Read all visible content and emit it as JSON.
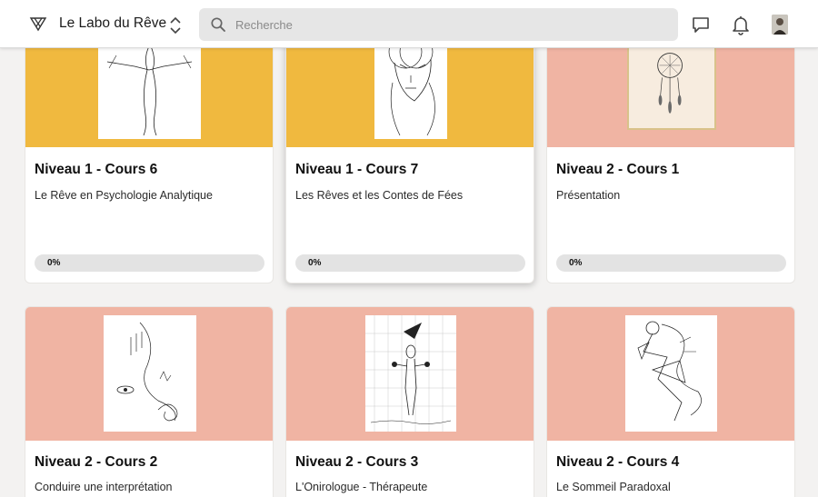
{
  "header": {
    "site_title": "Le Labo du Rêve",
    "search_placeholder": "Recherche",
    "icons": [
      "logo-icon",
      "switch-site-icon",
      "search-icon",
      "chat-icon",
      "bell-icon",
      "avatar"
    ]
  },
  "colors": {
    "banner_yellow": "#f0b93f",
    "banner_pink": "#f0b4a3",
    "page_bg": "#f3f2f1"
  },
  "cards": [
    {
      "title": "Niveau 1 - Cours 6",
      "subtitle": "Le Rêve en Psychologie Analytique",
      "progress_label": "0%",
      "progress": 0,
      "banner": "yellow"
    },
    {
      "title": "Niveau 1 - Cours 7",
      "subtitle": "Les Rêves et les Contes de Fées",
      "progress_label": "0%",
      "progress": 0,
      "banner": "yellow"
    },
    {
      "title": "Niveau 2 - Cours 1",
      "subtitle": "Présentation",
      "progress_label": "0%",
      "progress": 0,
      "banner": "pink"
    },
    {
      "title": "Niveau 2 - Cours 2",
      "subtitle": "Conduire une interprétation",
      "banner": "pink"
    },
    {
      "title": "Niveau 2 - Cours 3",
      "subtitle": "L'Onirologue - Thérapeute",
      "banner": "pink"
    },
    {
      "title": "Niveau 2 - Cours 4",
      "subtitle": "Le Sommeil Paradoxal",
      "banner": "pink"
    }
  ]
}
